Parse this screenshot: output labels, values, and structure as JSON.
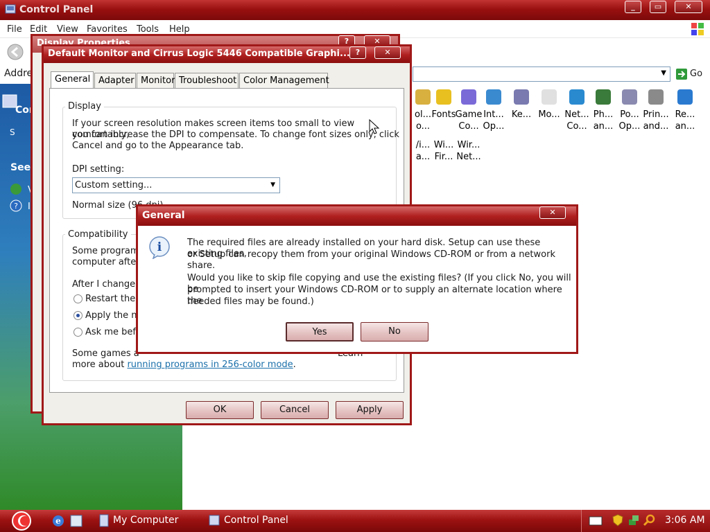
{
  "control_panel": {
    "title": "Control Panel",
    "menu": [
      "File",
      "Edit",
      "View",
      "Favorites",
      "Tools",
      "Help"
    ],
    "address_label": "Addre",
    "go_label": "Go",
    "left_pane": {
      "header_partial": "Cor",
      "item_partial": "S",
      "see_also_partial": "See",
      "link1_partial": "V",
      "link2_partial": "I"
    },
    "icons": [
      {
        "label": "ol...",
        "sub": "o..."
      },
      {
        "label": "Fonts",
        "sub": ""
      },
      {
        "label": "Game",
        "sub": "Co..."
      },
      {
        "label": "Int...",
        "sub": "Op..."
      },
      {
        "label": "Ke...",
        "sub": ""
      },
      {
        "label": "Mo...",
        "sub": ""
      },
      {
        "label": "Net...",
        "sub": "Co..."
      },
      {
        "label": "Ph...",
        "sub": "an..."
      },
      {
        "label": "Po...",
        "sub": "Op..."
      },
      {
        "label": "Prin...",
        "sub": "and..."
      },
      {
        "label": "Re...",
        "sub": "an..."
      }
    ],
    "icons_row2": [
      {
        "label": "/i...",
        "sub": "a..."
      },
      {
        "label": "Wi...",
        "sub": "Fir..."
      },
      {
        "label": "Wir...",
        "sub": "Net..."
      }
    ]
  },
  "display_properties": {
    "title": "Display Properties",
    "back_partial": "B"
  },
  "monitor_dialog": {
    "title": "Default Monitor and Cirrus Logic 5446 Compatible Graphi...",
    "tabs": [
      "General",
      "Adapter",
      "Monitor",
      "Troubleshoot",
      "Color Management"
    ],
    "display_group": "Display",
    "display_text_1": "If your screen resolution makes screen items too small to view comfortably,",
    "display_text_2": "you can increase the DPI to compensate.  To change font sizes only, click",
    "display_text_3": "Cancel and go to the Appearance tab.",
    "dpi_label": "DPI setting:",
    "dpi_value": "Custom setting...",
    "normal_size": "Normal size (96 dpi)",
    "compat_group": "Compatibility",
    "compat_text_1": "Some programs",
    "compat_text_2": "computer after c",
    "after_change": "After I change d",
    "radio_1": "Restart the c",
    "radio_2": "Apply the ne",
    "radio_3": "Ask me befo",
    "games_text_1": "Some games a",
    "games_text_1_end": "Learn",
    "games_text_2": "more about ",
    "games_link": "running programs in 256-color mode",
    "games_text_end": ".",
    "ok": "OK",
    "cancel": "Cancel",
    "apply": "Apply"
  },
  "general_dialog": {
    "title": "General",
    "msg_1": "The required files are already installed on your hard disk. Setup can use these existing files,",
    "msg_2": "or Setup can recopy them from your original Windows CD-ROM or from a network share.",
    "msg_3": "Would you like to skip file copying and use the existing files? (If you click No, you will be",
    "msg_4": "prompted to insert your Windows CD-ROM or to supply an alternate location where the",
    "msg_5": "needed files may be found.)",
    "yes": "Yes",
    "no": "No"
  },
  "taskbar": {
    "tasks": [
      "My Computer",
      "Control Panel"
    ],
    "clock": "3:06 AM"
  },
  "colors": {
    "title_red": "#9a1010",
    "accent": "#a01818",
    "link": "#1a6faa"
  }
}
